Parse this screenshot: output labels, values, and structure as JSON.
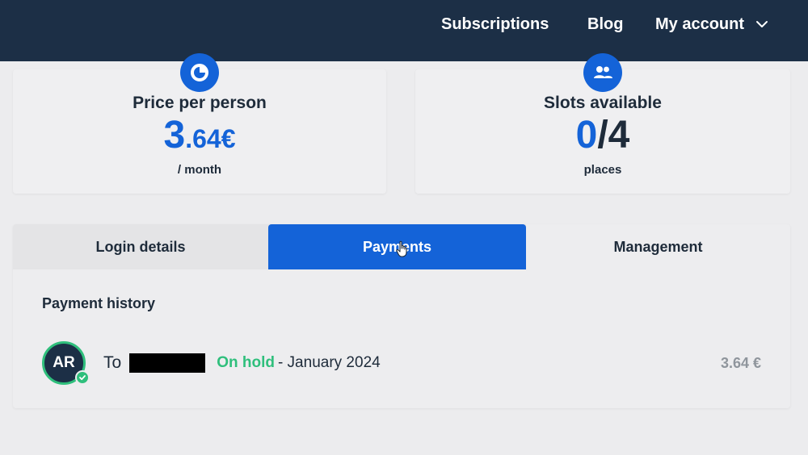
{
  "nav": {
    "subscriptions": "Subscriptions",
    "blog": "Blog",
    "account": "My account"
  },
  "cards": {
    "price": {
      "title": "Price per person",
      "value_int": "3",
      "value_dec": ".64€",
      "subtitle": "/ month",
      "icon": "pie-chart-icon"
    },
    "slots": {
      "title": "Slots available",
      "taken": "0",
      "separator": "/",
      "total": "4",
      "subtitle": "places",
      "icon": "people-icon"
    }
  },
  "tabs": {
    "login": "Login details",
    "payments": "Payments",
    "management": "Management",
    "active": "payments"
  },
  "payment_history": {
    "title": "Payment history",
    "items": [
      {
        "avatar": "AR",
        "to_label": "To",
        "status": "On hold",
        "date_text": "- January 2024",
        "amount": "3.64 €"
      }
    ]
  },
  "colors": {
    "nav_bg": "#1c2f46",
    "accent": "#1463d8",
    "success": "#2fbf7c",
    "muted": "#8f959c"
  }
}
